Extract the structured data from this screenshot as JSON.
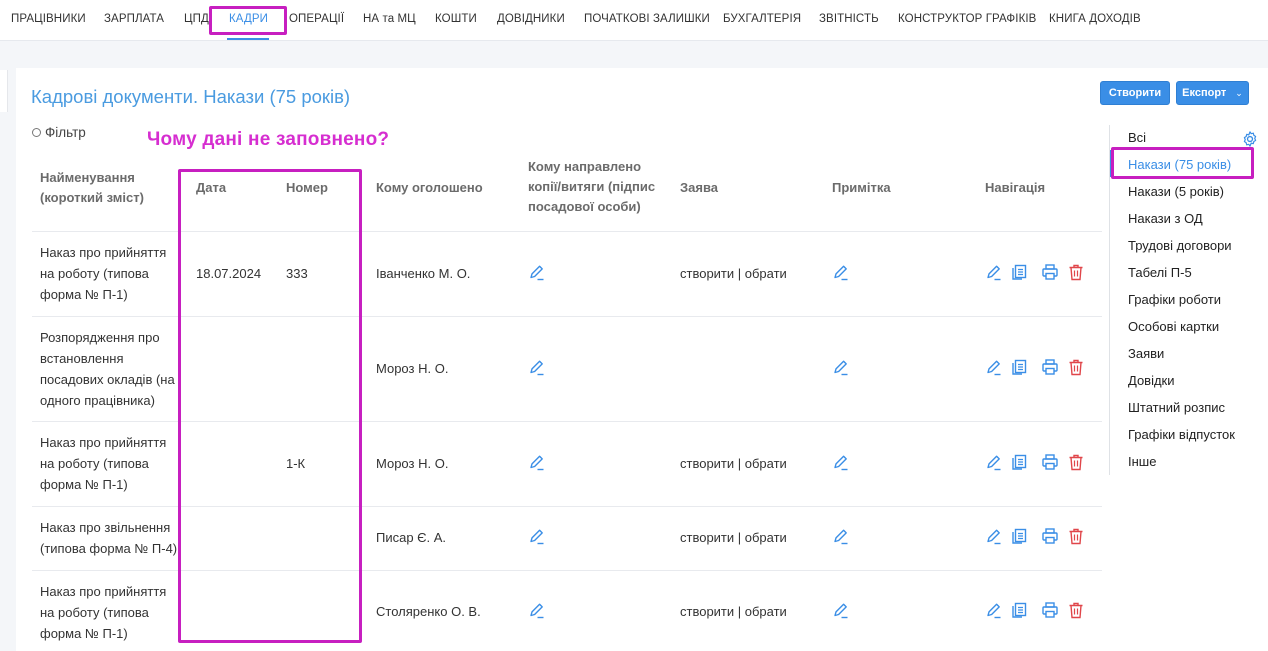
{
  "nav": {
    "items": [
      "ПРАЦІВНИКИ",
      "ЗАРПЛАТА",
      "ЦПД",
      "КАДРИ",
      "ОПЕРАЦІЇ",
      "НА та МЦ",
      "КОШТИ",
      "ДОВІДНИКИ",
      "ПОЧАТКОВІ ЗАЛИШКИ",
      "БУХГАЛТЕРІЯ",
      "ЗВІТНІСТЬ",
      "КОНСТРУКТОР ГРАФІКІВ",
      "КНИГА ДОХОДІВ"
    ],
    "active": "КАДРИ"
  },
  "page": {
    "title": "Кадрові документи. Накази (75 років)",
    "create_label": "Створити",
    "export_label": "Експорт",
    "filter_label": "Фільтр"
  },
  "annotation": "Чому дані не заповнено?",
  "table": {
    "headers": {
      "name": [
        "Найменування",
        "(короткий зміст)"
      ],
      "date": "Дата",
      "number": "Номер",
      "announced": "Кому оголошено",
      "copies": [
        "Кому направлено",
        "копії/витяги (підпис",
        "посадової особи)"
      ],
      "application": "Заява",
      "note": "Примітка",
      "navigation": "Навігація"
    },
    "rows": [
      {
        "name": [
          "Наказ про прийняття",
          "на роботу (типова",
          "форма № П-1)"
        ],
        "date": "18.07.2024",
        "number": "333",
        "announced": "Іванченко М. О.",
        "application": "створити | обрати"
      },
      {
        "name": [
          "Розпорядження про",
          "встановлення",
          "посадових окладів (на",
          "одного працівника)"
        ],
        "date": "",
        "number": "",
        "announced": "Мороз Н. О.",
        "application": ""
      },
      {
        "name": [
          "Наказ про прийняття",
          "на роботу (типова",
          "форма № П-1)"
        ],
        "date": "",
        "number": "1-К",
        "announced": "Мороз Н. О.",
        "application": "створити | обрати"
      },
      {
        "name": [
          "Наказ про звільнення",
          "(типова форма № П-4)"
        ],
        "date": "",
        "number": "",
        "announced": "Писар Є. А.",
        "application": "створити | обрати"
      },
      {
        "name": [
          "Наказ про прийняття",
          "на роботу (типова",
          "форма № П-1)"
        ],
        "date": "",
        "number": "",
        "announced": "Столяренко О. В.",
        "application": "створити | обрати"
      }
    ]
  },
  "sidebar": {
    "items": [
      "Всі",
      "Накази (75 років)",
      "Накази (5 років)",
      "Накази з ОД",
      "Трудові договори",
      "Табелі П-5",
      "Графіки роботи",
      "Особові картки",
      "Заяви",
      "Довідки",
      "Штатний розпис",
      "Графіки відпусток",
      "Інше"
    ],
    "active": "Накази (75 років)"
  },
  "colors": {
    "accent": "#3a8ee6",
    "highlight": "#c71fc0",
    "delete": "#e0464a"
  }
}
